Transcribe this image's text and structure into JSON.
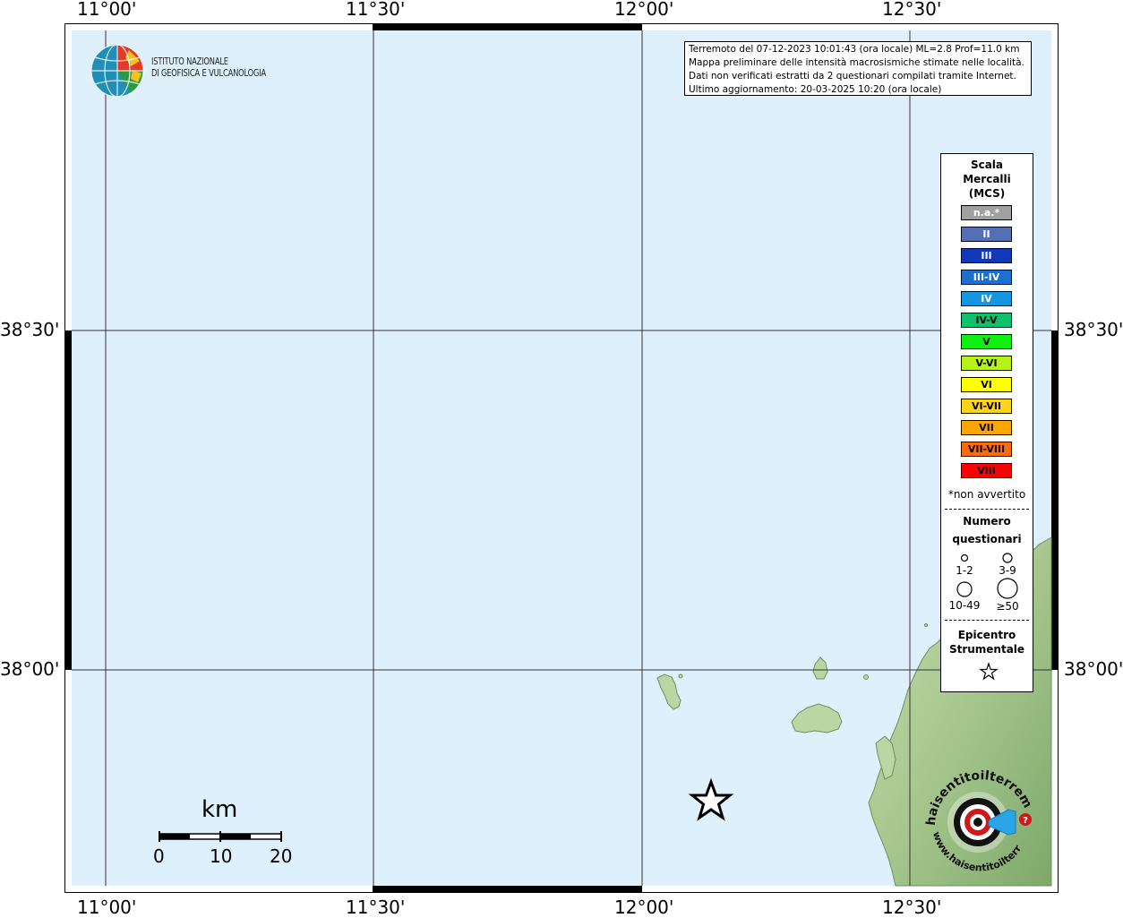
{
  "map": {
    "axes": {
      "lon_top": [
        "11°00'",
        "11°30'",
        "12°00'",
        "12°30'"
      ],
      "lon_bottom": [
        "11°00'",
        "11°30'",
        "12°00'",
        "12°30'"
      ],
      "lat_left": [
        "38°30'",
        "38°00'"
      ],
      "lat_right": [
        "38°30'",
        "38°00'"
      ]
    },
    "colors": {
      "sea": "#ddf0fc",
      "land_light": "#b9d6a3",
      "land_mid": "#8fb77a",
      "land_dark": "#6f9a5e",
      "grid": "#333333"
    }
  },
  "institute": {
    "line1": "ISTITUTO NAZIONALE",
    "line2": "DI GEOFISICA E VULCANOLOGIA"
  },
  "info": {
    "line1": "Terremoto del 07-12-2023 10:01:43 (ora locale) ML=2.8 Prof=11.0 km",
    "line2": "Mappa preliminare delle intensità macrosismiche stimate nelle località.",
    "line3": "Dati non verificati estratti da 2 questionari compilati tramite Internet.",
    "line4": "Ultimo aggiornamento: 20-03-2025 10:20 (ora locale)"
  },
  "legend": {
    "title_lines": [
      "Scala",
      "Mercalli",
      "(MCS)"
    ],
    "intensities": [
      {
        "label": "n.a.*",
        "color": "#a0a0a0"
      },
      {
        "label": "II",
        "color": "#5470b5"
      },
      {
        "label": "III",
        "color": "#1038b8"
      },
      {
        "label": "III-IV",
        "color": "#1d6fd0"
      },
      {
        "label": "IV",
        "color": "#1496e2"
      },
      {
        "label": "IV-V",
        "color": "#0fc06d"
      },
      {
        "label": "V",
        "color": "#10f010"
      },
      {
        "label": "V-VI",
        "color": "#b6f21a"
      },
      {
        "label": "VI",
        "color": "#ffff00"
      },
      {
        "label": "VI-VII",
        "color": "#ffd31a"
      },
      {
        "label": "VII",
        "color": "#ffa500"
      },
      {
        "label": "VII-VIII",
        "color": "#ff6a0a"
      },
      {
        "label": "VIII",
        "color": "#ff0000"
      }
    ],
    "note": "*non avvertito",
    "count_title_lines": [
      "Numero",
      "questionari"
    ],
    "count_sizes": [
      "1-2",
      "3-9",
      "10-49",
      "≥50"
    ],
    "epicenter_title_lines": [
      "Epicentro",
      "Strumentale"
    ]
  },
  "scalebar": {
    "unit": "km",
    "ticks": [
      "0",
      "10",
      "20"
    ]
  },
  "hsit": {
    "text_top": "haisentitoilterremoto.it",
    "text_bottom": "www.haisentitoilterremoto.it"
  }
}
